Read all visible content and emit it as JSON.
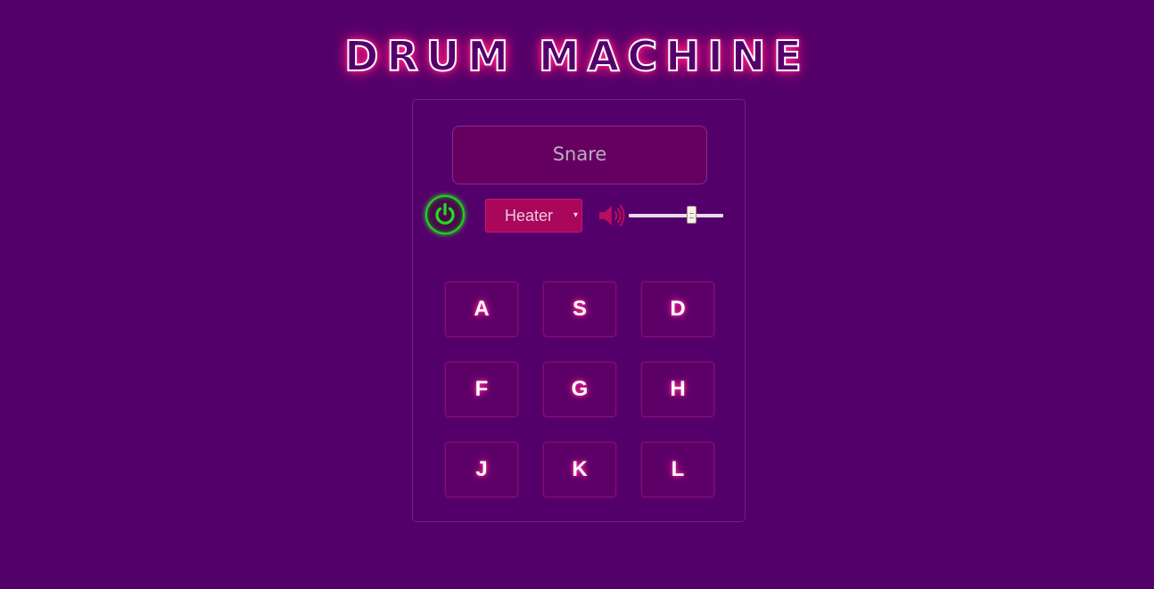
{
  "header": {
    "title": "DRUM MACHINE"
  },
  "display": {
    "text": "Snare"
  },
  "controls": {
    "power": {
      "icon": "power-icon",
      "state": "on",
      "color": "#1cd61c"
    },
    "kit_select": {
      "selected": "Heater",
      "arrow": "▾"
    },
    "volume": {
      "icon": "speaker-icon",
      "level": 0.68
    }
  },
  "pads": [
    {
      "key": "A"
    },
    {
      "key": "S"
    },
    {
      "key": "D"
    },
    {
      "key": "F"
    },
    {
      "key": "G"
    },
    {
      "key": "H"
    },
    {
      "key": "J"
    },
    {
      "key": "K"
    },
    {
      "key": "L"
    }
  ],
  "colors": {
    "background": "#54006a",
    "accent": "#a9065c",
    "neon": "#ff1f8a",
    "power_on": "#1cd61c"
  }
}
